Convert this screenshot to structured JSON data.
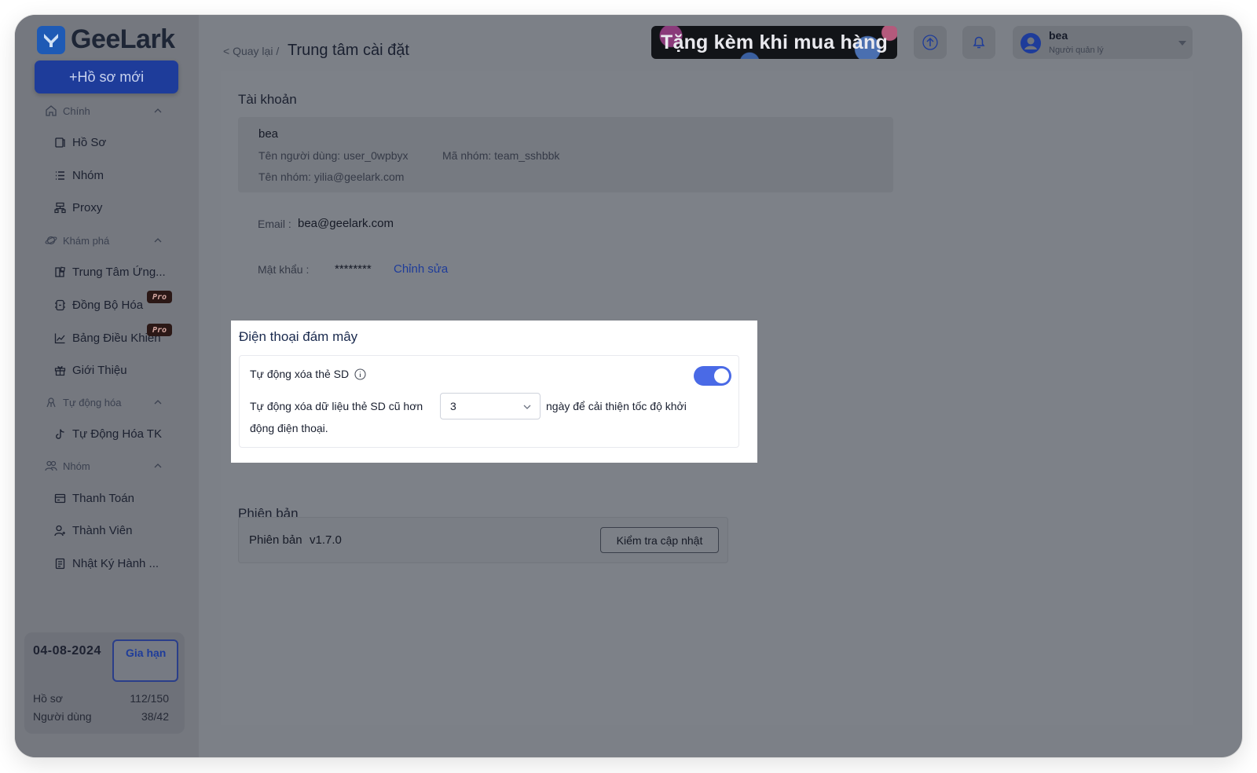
{
  "app": {
    "logo_text": "GeeLark"
  },
  "sidebar": {
    "new_profile_label": "+Hồ sơ mới",
    "sections": [
      {
        "label": "Chính",
        "items": [
          {
            "label": "Hồ Sơ"
          },
          {
            "label": "Nhóm"
          },
          {
            "label": "Proxy"
          }
        ]
      },
      {
        "label": "Khám phá",
        "items": [
          {
            "label": "Trung Tâm Ứng..."
          },
          {
            "label": "Đồng Bộ Hóa",
            "badge": "Pro"
          },
          {
            "label": "Bảng Điều Khiển",
            "badge": "Pro"
          },
          {
            "label": "Giới Thiệu"
          }
        ]
      },
      {
        "label": "Tự động hóa",
        "items": [
          {
            "label": "Tự Động Hóa TK"
          }
        ]
      },
      {
        "label": "Nhóm",
        "items": [
          {
            "label": "Thanh Toán"
          },
          {
            "label": "Thành Viên"
          },
          {
            "label": "Nhật Ký Hành ..."
          }
        ]
      }
    ],
    "plan": {
      "date": "04-08-2024",
      "renew_label": "Gia hạn",
      "profiles_label": "Hồ sơ",
      "profiles_value": "112/150",
      "users_label": "Người dùng",
      "users_value": "38/42"
    }
  },
  "header": {
    "back_label": "< Quay lại /",
    "title": "Trung tâm cài đặt",
    "promo_text": "Tặng kèm khi mua hàng",
    "user_name": "bea",
    "user_role": "Người quản lý"
  },
  "account": {
    "section_title": "Tài khoản",
    "name": "bea",
    "username": "Tên người dùng: user_0wpbyx",
    "team_code": "Mã nhóm: team_sshbbk",
    "team_name": "Tên nhóm: yilia@geelark.com",
    "email_label": "Email :",
    "email_value": "bea@geelark.com",
    "password_label": "Mật khẩu :",
    "password_value": "********",
    "edit_label": "Chỉnh sửa"
  },
  "cloud_phone": {
    "section_title": "Điện thoại đám mây",
    "auto_clear_label": "Tự động xóa thẻ SD",
    "auto_clear_enabled": true,
    "desc_before": "Tự động xóa dữ liệu thẻ SD cũ hơn",
    "days_value": "3",
    "desc_after": "ngày để cải thiện tốc độ khởi",
    "desc_wrap": "động điện thoại."
  },
  "version": {
    "section_title": "Phiên bản",
    "label": "Phiên bản",
    "value": "v1.7.0",
    "check_label": "Kiểm tra cập nhật"
  },
  "colors": {
    "brand": "#1e5ab5",
    "toggle_on": "#4a6ae6",
    "link": "#1e3c9a",
    "overlay": "#7c8087"
  }
}
